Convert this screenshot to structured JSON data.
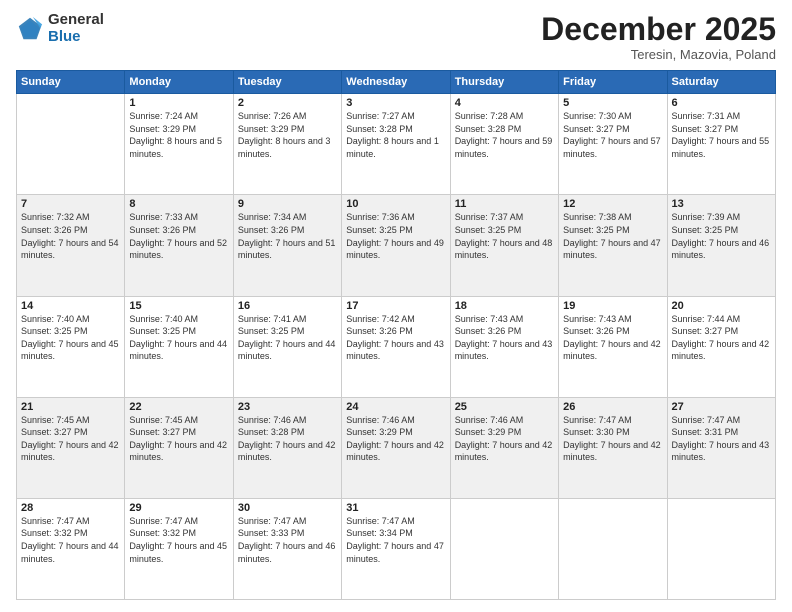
{
  "logo": {
    "general": "General",
    "blue": "Blue"
  },
  "header": {
    "month": "December 2025",
    "location": "Teresin, Mazovia, Poland"
  },
  "weekdays": [
    "Sunday",
    "Monday",
    "Tuesday",
    "Wednesday",
    "Thursday",
    "Friday",
    "Saturday"
  ],
  "weeks": [
    [
      {
        "day": "",
        "sunrise": "",
        "sunset": "",
        "daylight": ""
      },
      {
        "day": "1",
        "sunrise": "Sunrise: 7:24 AM",
        "sunset": "Sunset: 3:29 PM",
        "daylight": "Daylight: 8 hours and 5 minutes."
      },
      {
        "day": "2",
        "sunrise": "Sunrise: 7:26 AM",
        "sunset": "Sunset: 3:29 PM",
        "daylight": "Daylight: 8 hours and 3 minutes."
      },
      {
        "day": "3",
        "sunrise": "Sunrise: 7:27 AM",
        "sunset": "Sunset: 3:28 PM",
        "daylight": "Daylight: 8 hours and 1 minute."
      },
      {
        "day": "4",
        "sunrise": "Sunrise: 7:28 AM",
        "sunset": "Sunset: 3:28 PM",
        "daylight": "Daylight: 7 hours and 59 minutes."
      },
      {
        "day": "5",
        "sunrise": "Sunrise: 7:30 AM",
        "sunset": "Sunset: 3:27 PM",
        "daylight": "Daylight: 7 hours and 57 minutes."
      },
      {
        "day": "6",
        "sunrise": "Sunrise: 7:31 AM",
        "sunset": "Sunset: 3:27 PM",
        "daylight": "Daylight: 7 hours and 55 minutes."
      }
    ],
    [
      {
        "day": "7",
        "sunrise": "Sunrise: 7:32 AM",
        "sunset": "Sunset: 3:26 PM",
        "daylight": "Daylight: 7 hours and 54 minutes."
      },
      {
        "day": "8",
        "sunrise": "Sunrise: 7:33 AM",
        "sunset": "Sunset: 3:26 PM",
        "daylight": "Daylight: 7 hours and 52 minutes."
      },
      {
        "day": "9",
        "sunrise": "Sunrise: 7:34 AM",
        "sunset": "Sunset: 3:26 PM",
        "daylight": "Daylight: 7 hours and 51 minutes."
      },
      {
        "day": "10",
        "sunrise": "Sunrise: 7:36 AM",
        "sunset": "Sunset: 3:25 PM",
        "daylight": "Daylight: 7 hours and 49 minutes."
      },
      {
        "day": "11",
        "sunrise": "Sunrise: 7:37 AM",
        "sunset": "Sunset: 3:25 PM",
        "daylight": "Daylight: 7 hours and 48 minutes."
      },
      {
        "day": "12",
        "sunrise": "Sunrise: 7:38 AM",
        "sunset": "Sunset: 3:25 PM",
        "daylight": "Daylight: 7 hours and 47 minutes."
      },
      {
        "day": "13",
        "sunrise": "Sunrise: 7:39 AM",
        "sunset": "Sunset: 3:25 PM",
        "daylight": "Daylight: 7 hours and 46 minutes."
      }
    ],
    [
      {
        "day": "14",
        "sunrise": "Sunrise: 7:40 AM",
        "sunset": "Sunset: 3:25 PM",
        "daylight": "Daylight: 7 hours and 45 minutes."
      },
      {
        "day": "15",
        "sunrise": "Sunrise: 7:40 AM",
        "sunset": "Sunset: 3:25 PM",
        "daylight": "Daylight: 7 hours and 44 minutes."
      },
      {
        "day": "16",
        "sunrise": "Sunrise: 7:41 AM",
        "sunset": "Sunset: 3:25 PM",
        "daylight": "Daylight: 7 hours and 44 minutes."
      },
      {
        "day": "17",
        "sunrise": "Sunrise: 7:42 AM",
        "sunset": "Sunset: 3:26 PM",
        "daylight": "Daylight: 7 hours and 43 minutes."
      },
      {
        "day": "18",
        "sunrise": "Sunrise: 7:43 AM",
        "sunset": "Sunset: 3:26 PM",
        "daylight": "Daylight: 7 hours and 43 minutes."
      },
      {
        "day": "19",
        "sunrise": "Sunrise: 7:43 AM",
        "sunset": "Sunset: 3:26 PM",
        "daylight": "Daylight: 7 hours and 42 minutes."
      },
      {
        "day": "20",
        "sunrise": "Sunrise: 7:44 AM",
        "sunset": "Sunset: 3:27 PM",
        "daylight": "Daylight: 7 hours and 42 minutes."
      }
    ],
    [
      {
        "day": "21",
        "sunrise": "Sunrise: 7:45 AM",
        "sunset": "Sunset: 3:27 PM",
        "daylight": "Daylight: 7 hours and 42 minutes."
      },
      {
        "day": "22",
        "sunrise": "Sunrise: 7:45 AM",
        "sunset": "Sunset: 3:27 PM",
        "daylight": "Daylight: 7 hours and 42 minutes."
      },
      {
        "day": "23",
        "sunrise": "Sunrise: 7:46 AM",
        "sunset": "Sunset: 3:28 PM",
        "daylight": "Daylight: 7 hours and 42 minutes."
      },
      {
        "day": "24",
        "sunrise": "Sunrise: 7:46 AM",
        "sunset": "Sunset: 3:29 PM",
        "daylight": "Daylight: 7 hours and 42 minutes."
      },
      {
        "day": "25",
        "sunrise": "Sunrise: 7:46 AM",
        "sunset": "Sunset: 3:29 PM",
        "daylight": "Daylight: 7 hours and 42 minutes."
      },
      {
        "day": "26",
        "sunrise": "Sunrise: 7:47 AM",
        "sunset": "Sunset: 3:30 PM",
        "daylight": "Daylight: 7 hours and 42 minutes."
      },
      {
        "day": "27",
        "sunrise": "Sunrise: 7:47 AM",
        "sunset": "Sunset: 3:31 PM",
        "daylight": "Daylight: 7 hours and 43 minutes."
      }
    ],
    [
      {
        "day": "28",
        "sunrise": "Sunrise: 7:47 AM",
        "sunset": "Sunset: 3:32 PM",
        "daylight": "Daylight: 7 hours and 44 minutes."
      },
      {
        "day": "29",
        "sunrise": "Sunrise: 7:47 AM",
        "sunset": "Sunset: 3:32 PM",
        "daylight": "Daylight: 7 hours and 45 minutes."
      },
      {
        "day": "30",
        "sunrise": "Sunrise: 7:47 AM",
        "sunset": "Sunset: 3:33 PM",
        "daylight": "Daylight: 7 hours and 46 minutes."
      },
      {
        "day": "31",
        "sunrise": "Sunrise: 7:47 AM",
        "sunset": "Sunset: 3:34 PM",
        "daylight": "Daylight: 7 hours and 47 minutes."
      },
      {
        "day": "",
        "sunrise": "",
        "sunset": "",
        "daylight": ""
      },
      {
        "day": "",
        "sunrise": "",
        "sunset": "",
        "daylight": ""
      },
      {
        "day": "",
        "sunrise": "",
        "sunset": "",
        "daylight": ""
      }
    ]
  ]
}
